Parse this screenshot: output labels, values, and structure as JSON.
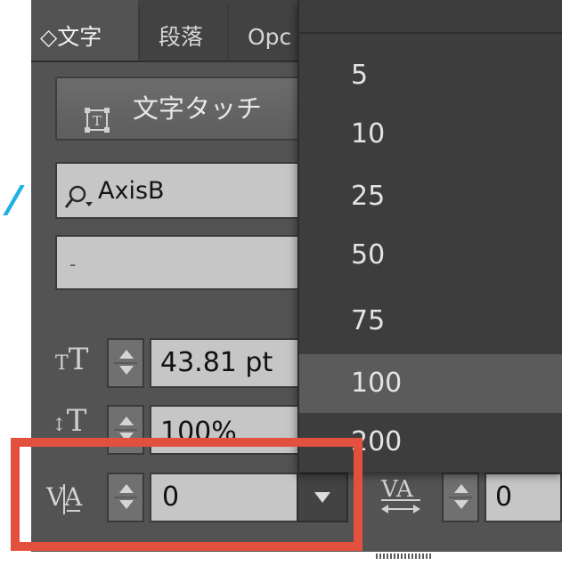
{
  "panel": {
    "tabs": [
      {
        "label": "◇文字",
        "active": true
      },
      {
        "label": "段落",
        "active": false
      },
      {
        "label": "Opc",
        "active": false
      }
    ],
    "touch_button": {
      "label": "文字タッチ",
      "icon": "touch-type-icon"
    },
    "font_family": {
      "value": "AxisB",
      "icon": "search-icon"
    },
    "font_style": {
      "value": "-"
    },
    "font_size": {
      "value": "43.81 pt",
      "icon": "font-size-icon"
    },
    "leading": {
      "value": "100%",
      "icon": "leading-icon"
    },
    "kerning": {
      "value": "0",
      "icon": "kerning-icon"
    },
    "tracking": {
      "value": "0",
      "icon": "tracking-icon"
    }
  },
  "dropdown_menu": {
    "items": [
      "5",
      "10",
      "25",
      "50",
      "75",
      "100",
      "200"
    ],
    "highlighted": "100"
  },
  "annotation": {
    "color": "#e4503e",
    "accent": "#1fb1e6"
  }
}
